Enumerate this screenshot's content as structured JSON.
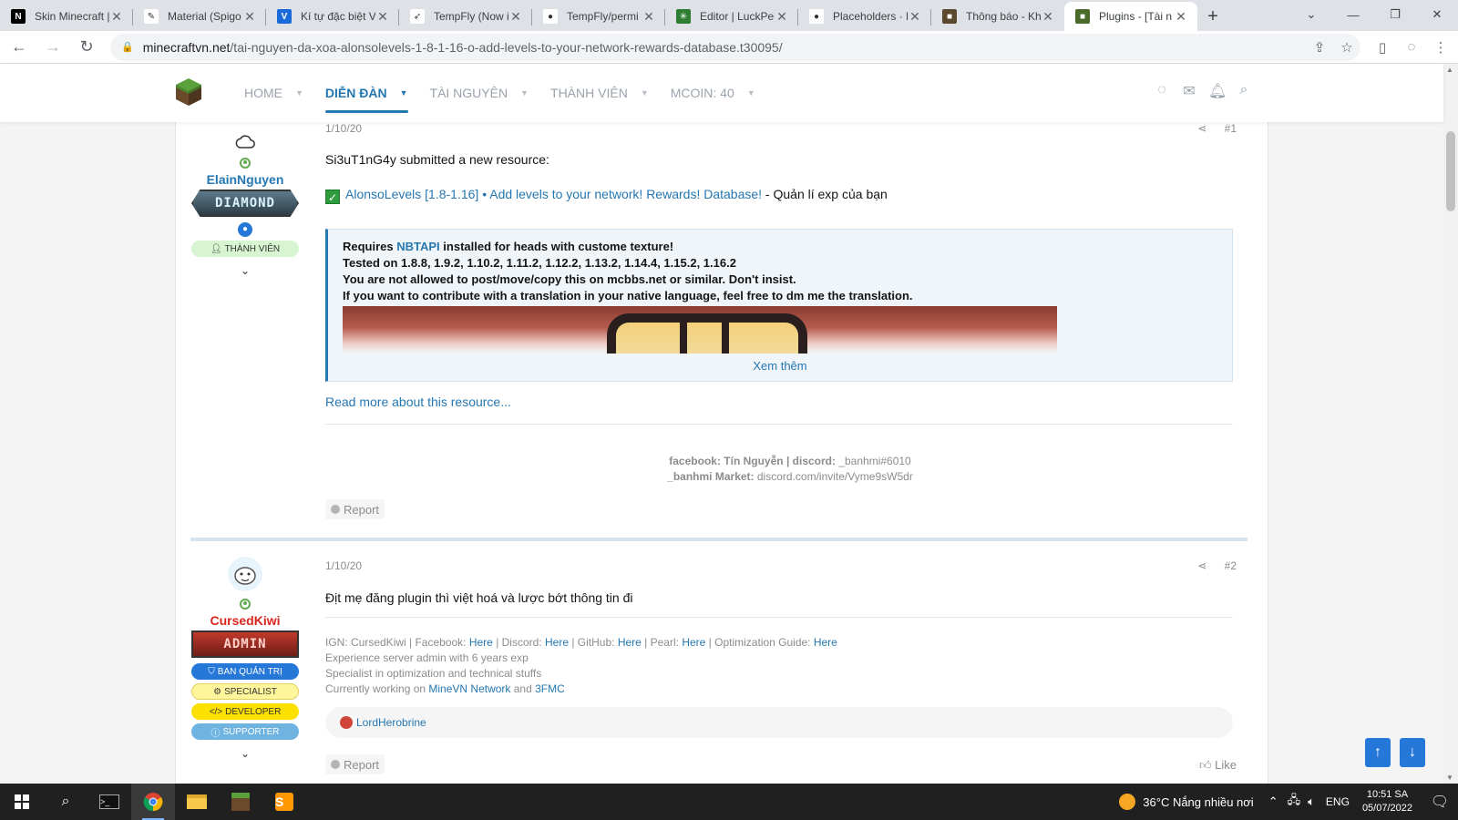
{
  "browser": {
    "tabs": [
      {
        "title": "Skin Minecraft |",
        "fav": "#000000",
        "glyph": "N"
      },
      {
        "title": "Material (Spigo",
        "fav": "#ffffff",
        "glyph": "✎"
      },
      {
        "title": "Kí tự đặc biệt V",
        "fav": "#1a6bd8",
        "glyph": "V"
      },
      {
        "title": "TempFly (Now i",
        "fav": "#ffffff",
        "glyph": "➶"
      },
      {
        "title": "TempFly/permi",
        "fav": "#ffffff",
        "glyph": "●"
      },
      {
        "title": "Editor | LuckPer",
        "fav": "#2e7d32",
        "glyph": "✳"
      },
      {
        "title": "Placeholders · P",
        "fav": "#ffffff",
        "glyph": "●"
      },
      {
        "title": "Thông báo - Kh",
        "fav": "#5d4a2e",
        "glyph": "■"
      },
      {
        "title": "Plugins - [Tài n",
        "fav": "#4a6b2a",
        "glyph": "■",
        "active": true
      }
    ],
    "url_host": "minecraftvn.net",
    "url_path": "/tai-nguyen-da-xoa-alonsolevels-1-8-1-16-o-add-levels-to-your-network-rewards-database.t30095/"
  },
  "site": {
    "nav": [
      {
        "label": "HOME"
      },
      {
        "label": "DIỄN ĐÀN",
        "active": true
      },
      {
        "label": "TÀI NGUYÊN"
      },
      {
        "label": "THÀNH VIÊN"
      },
      {
        "label": "MCOIN: 40"
      }
    ],
    "accent": "#2577b1"
  },
  "posts": {
    "p1": {
      "date": "1/10/20",
      "num": "#1",
      "username": "ElainNguyen",
      "username_color": "#2577b1",
      "banner": "DIAMOND",
      "role": "THÀNH VIÊN",
      "intro": "Si3uT1nG4y submitted a new resource:",
      "resource_link": "AlonsoLevels [1.8-1.16] • Add levels to your network! Rewards! Database!",
      "resource_desc": " - Quản lí exp của bạn",
      "quote_line1_pre": "Requires ",
      "quote_line1_link": "NBTAPI",
      "quote_line1_post": " installed for heads with custome texture!",
      "quote_line2": "Tested on 1.8.8, 1.9.2, 1.10.2, 1.11.2, 1.12.2, 1.13.2, 1.14.4, 1.15.2, 1.16.2",
      "quote_line3": "You are not allowed to post/move/copy this on mcbbs.net or similar. Don't insist.",
      "quote_line4": "If you want to contribute with a translation in your native language, feel free to dm me the translation.",
      "expand": "Xem thêm",
      "read_more": "Read more about this resource...",
      "sig_fb_label": "facebook: ",
      "sig_fb_name": "Tín Nguyễn",
      "sig_discord_label": " | discord: ",
      "sig_discord": "_banhmi#6010",
      "sig_market_label": "_banhmi Market: ",
      "sig_market": "discord.com/invite/Vyme9sW5dr",
      "report": "Report"
    },
    "p2": {
      "date": "1/10/20",
      "num": "#2",
      "username": "CursedKiwi",
      "username_color": "#d9261c",
      "banner": "ADMIN",
      "badges": [
        "BAN QUẢN TRỊ",
        "SPECIALIST",
        "DEVELOPER",
        "SUPPORTER"
      ],
      "message": "Địt mẹ đăng plugin thì việt hoá và lược bớt thông tin đi",
      "sig_line1_pre": "IGN: CursedKiwi | Facebook: ",
      "sig_here": "Here",
      "sig_line1_a": " | Discord: ",
      "sig_line1_b": " | GitHub: ",
      "sig_line1_c": " | Pearl: ",
      "sig_line1_d": " | Optimization Guide: ",
      "sig_line2": "Experience server admin with 6 years exp",
      "sig_line3": "Specialist in optimization and technical stuffs",
      "sig_line4_pre": "Currently working on ",
      "sig_line4_link1": "MineVN Network",
      "sig_line4_mid": " and ",
      "sig_line4_link2": "3FMC",
      "reaction_user": "LordHerobrine",
      "report": "Report",
      "like": "Like"
    }
  },
  "taskbar": {
    "weather": "36°C  Nắng nhiều nơi",
    "lang": "ENG",
    "time": "10:51 SA",
    "date": "05/07/2022"
  }
}
